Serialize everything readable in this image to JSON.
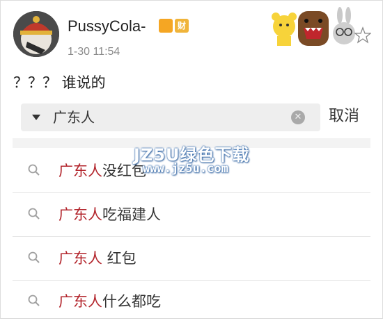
{
  "post": {
    "username": "PussyCola-",
    "badges": [
      "",
      "财"
    ],
    "timestamp": "1-30 11:54",
    "text": "？？？ 谁说的"
  },
  "search": {
    "value": "广东人",
    "cancel_label": "取消"
  },
  "suggestions": [
    {
      "highlight": "广东人",
      "rest": "没红包"
    },
    {
      "highlight": "广东人",
      "rest": "吃福建人"
    },
    {
      "highlight": "广东人",
      "rest": " 红包"
    },
    {
      "highlight": "广东人",
      "rest": "什么都吃"
    }
  ],
  "watermark": {
    "line1": "JZ5U绿色下载",
    "line2": "www.jz5u.com"
  },
  "icons": {
    "avatar": "avatar-image",
    "dropdown": "triangle-down-icon",
    "clear": "clear-circle-icon",
    "search": "magnifier-icon"
  },
  "colors": {
    "highlight": "#b3262d",
    "background": "#ffffff"
  }
}
